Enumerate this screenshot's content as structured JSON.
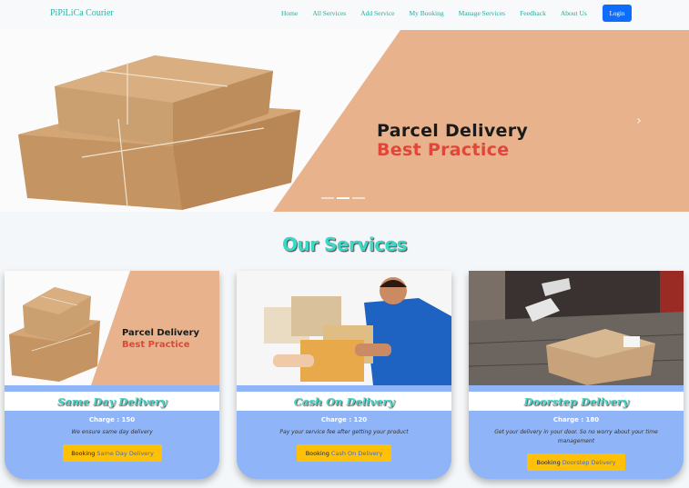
{
  "navbar": {
    "brand": "PiPiLiCa Courier",
    "links": [
      "Home",
      "All Services",
      "Add Service",
      "My Booking",
      "Manage Services",
      "Feedback",
      "About Us"
    ],
    "login_label": "Login"
  },
  "carousel": {
    "heading": "Parcel Delivery",
    "subheading": "Best Practice",
    "prev_icon": "‹",
    "next_icon": "›",
    "slide_count": 3,
    "active_slide": 2
  },
  "services": {
    "title": "Our Services",
    "cards": [
      {
        "name": "Same Day Delivery",
        "charge": "Charge : 150",
        "description": "We ensure same day delivery",
        "button_prefix": "Booking",
        "button_service": "Same Day Delivery",
        "image_heading": "Parcel Delivery",
        "image_subheading": "Best Practice"
      },
      {
        "name": "Cash On Delivery",
        "charge": "Charge : 120",
        "description": "Pay your service fee after getting your product",
        "button_prefix": "Booking",
        "button_service": "Cash On Delivery"
      },
      {
        "name": "Doorstep Delivery",
        "charge": "Charge : 180",
        "description": "Get your delivery in your door. So no worry about your time management",
        "button_prefix": "Booking",
        "button_service": "Doorstep Delivery"
      }
    ]
  },
  "colors": {
    "brand": "#2bb3a7",
    "login_button": "#0d6efd",
    "card_background": "#8fb4f7",
    "title_teal": "#3ad8c6",
    "booking_button": "#ffc107",
    "accent_red": "#e0463a"
  }
}
